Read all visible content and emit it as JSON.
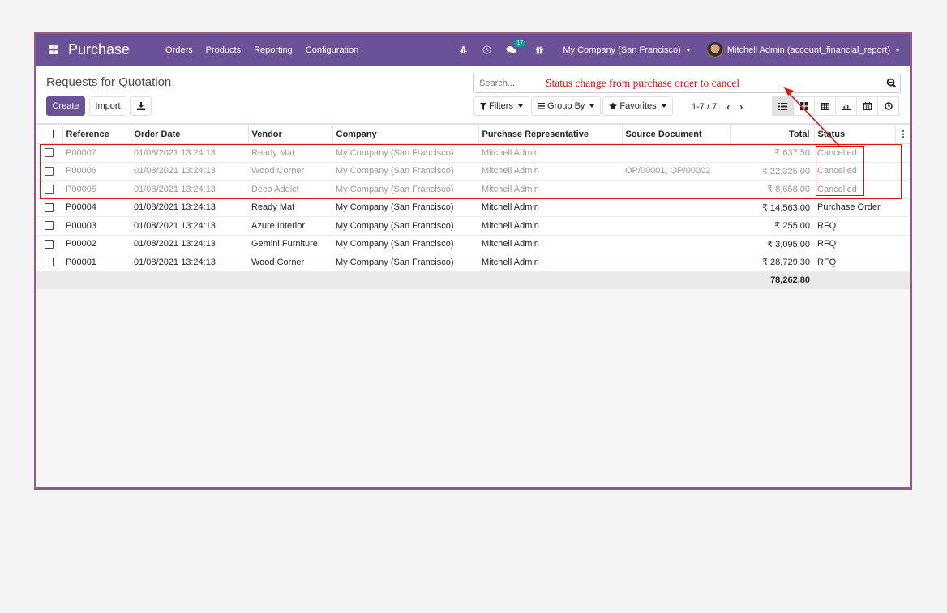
{
  "navbar": {
    "app_name": "Purchase",
    "menu": [
      "Orders",
      "Products",
      "Reporting",
      "Configuration"
    ],
    "message_count": "17",
    "company": "My Company (San Francisco)",
    "user": "Mitchell Admin (account_financial_report)",
    "icons": [
      "apps-grid-icon",
      "bug-icon",
      "clock-icon",
      "chat-icon",
      "gift-icon"
    ]
  },
  "control_panel": {
    "title": "Requests for Quotation",
    "create_label": "Create",
    "import_label": "Import",
    "search_placeholder": "Search...",
    "filters_label": "Filters",
    "group_by_label": "Group By",
    "favorites_label": "Favorites",
    "pager": "1-7 / 7",
    "views": [
      "list",
      "kanban",
      "pivot",
      "graph",
      "calendar",
      "activity"
    ],
    "active_view": "list"
  },
  "annotation": {
    "text": "Status change from purchase order to cancel",
    "color": "#e01010"
  },
  "table": {
    "columns": [
      "Reference",
      "Order Date",
      "Vendor",
      "Company",
      "Purchase Representative",
      "Source Document",
      "Total",
      "Status"
    ],
    "rows": [
      {
        "reference": "P00007",
        "order_date": "01/08/2021 13:24:13",
        "vendor": "Ready Mat",
        "company": "My Company (San Francisco)",
        "rep": "Mitchell Admin",
        "source": "",
        "total": "₹ 637.50",
        "status": "Cancelled",
        "cancelled": true
      },
      {
        "reference": "P00006",
        "order_date": "01/08/2021 13:24:13",
        "vendor": "Wood Corner",
        "company": "My Company (San Francisco)",
        "rep": "Mitchell Admin",
        "source": "OP/00001, OP/00002",
        "total": "₹ 22,325.00",
        "status": "Cancelled",
        "cancelled": true
      },
      {
        "reference": "P00005",
        "order_date": "01/08/2021 13:24:13",
        "vendor": "Deco Addict",
        "company": "My Company (San Francisco)",
        "rep": "Mitchell Admin",
        "source": "",
        "total": "₹ 8,658.00",
        "status": "Cancelled",
        "cancelled": true
      },
      {
        "reference": "P00004",
        "order_date": "01/08/2021 13:24:13",
        "vendor": "Ready Mat",
        "company": "My Company (San Francisco)",
        "rep": "Mitchell Admin",
        "source": "",
        "total": "₹ 14,563.00",
        "status": "Purchase Order",
        "cancelled": false
      },
      {
        "reference": "P00003",
        "order_date": "01/08/2021 13:24:13",
        "vendor": "Azure Interior",
        "company": "My Company (San Francisco)",
        "rep": "Mitchell Admin",
        "source": "",
        "total": "₹ 255.00",
        "status": "RFQ",
        "cancelled": false
      },
      {
        "reference": "P00002",
        "order_date": "01/08/2021 13:24:13",
        "vendor": "Gemini Furniture",
        "company": "My Company (San Francisco)",
        "rep": "Mitchell Admin",
        "source": "",
        "total": "₹ 3,095.00",
        "status": "RFQ",
        "cancelled": false
      },
      {
        "reference": "P00001",
        "order_date": "01/08/2021 13:24:13",
        "vendor": "Wood Corner",
        "company": "My Company (San Francisco)",
        "rep": "Mitchell Admin",
        "source": "",
        "total": "₹ 28,729.30",
        "status": "RFQ",
        "cancelled": false
      }
    ],
    "sum_total": "78,262.80"
  },
  "colors": {
    "brand": "#6b5198",
    "frame": "#8a5f83",
    "badge": "#00a09d"
  }
}
